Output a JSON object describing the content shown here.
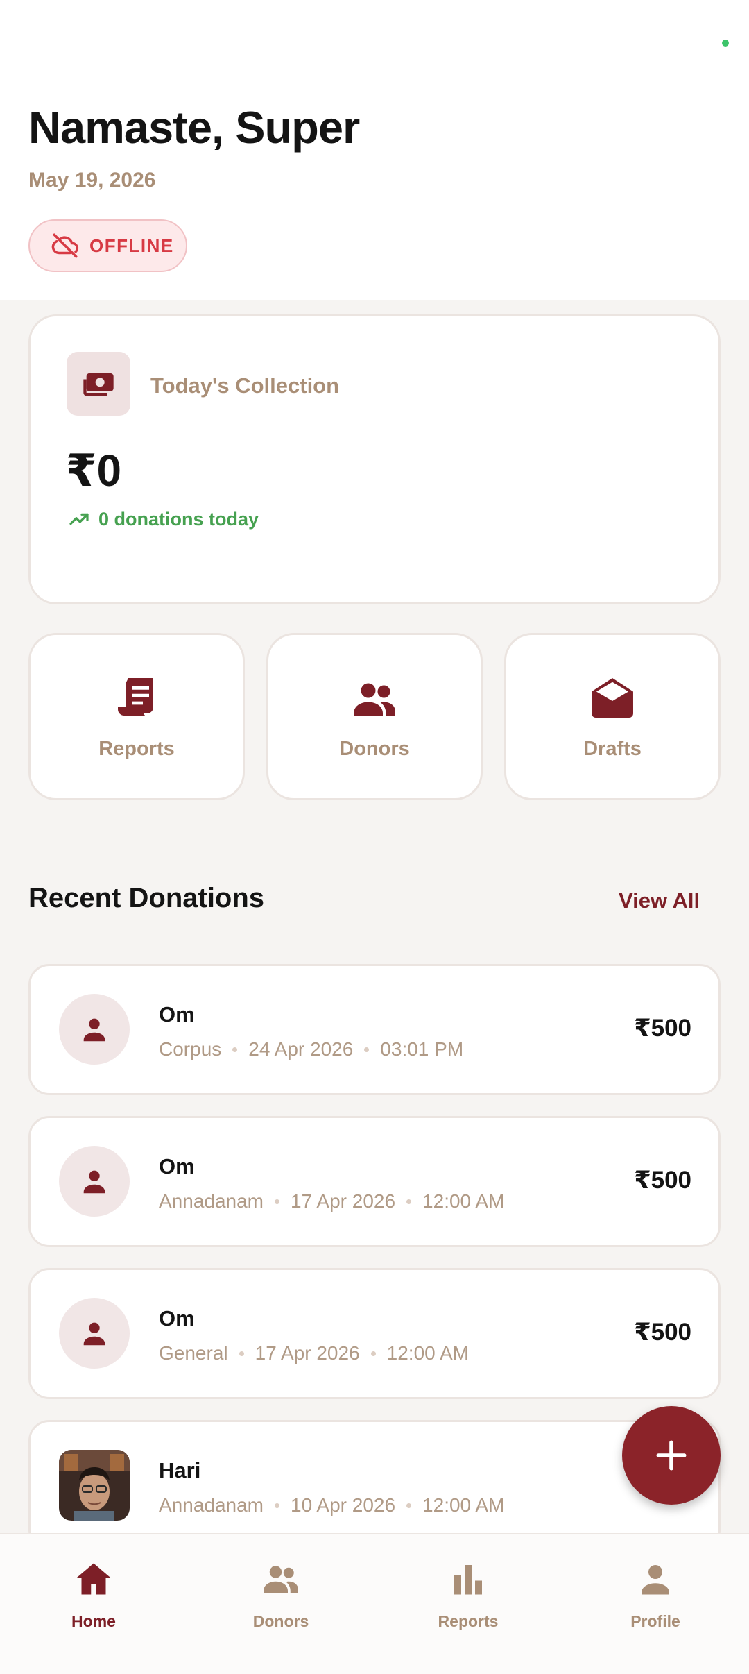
{
  "header": {
    "greeting": "Namaste, Super",
    "date": "May 19, 2026",
    "connection_status": "OFFLINE",
    "status_icon": "cloud-off-icon"
  },
  "collection": {
    "title": "Today's Collection",
    "amount": "₹0",
    "donations_today": "0 donations today",
    "icon": "payments-icon",
    "trend_icon": "trending-up-icon"
  },
  "quick_actions": [
    {
      "label": "Reports",
      "icon": "receipt-icon"
    },
    {
      "label": "Donors",
      "icon": "people-icon"
    },
    {
      "label": "Drafts",
      "icon": "drafts-icon"
    }
  ],
  "recent": {
    "title": "Recent Donations",
    "view_all": "View All",
    "items": [
      {
        "name": "Om",
        "category": "Corpus",
        "date": "24 Apr 2026",
        "time": "03:01 PM",
        "amount": "₹500",
        "avatar": "person-icon"
      },
      {
        "name": "Om",
        "category": "Annadanam",
        "date": "17 Apr 2026",
        "time": "12:00 AM",
        "amount": "₹500",
        "avatar": "person-icon"
      },
      {
        "name": "Om",
        "category": "General",
        "date": "17 Apr 2026",
        "time": "12:00 AM",
        "amount": "₹500",
        "avatar": "person-icon"
      },
      {
        "name": "Hari",
        "category": "Annadanam",
        "date": "10 Apr 2026",
        "time": "12:00 AM",
        "amount": "",
        "avatar": "photo"
      }
    ]
  },
  "fab": {
    "icon": "add-icon"
  },
  "nav": {
    "items": [
      {
        "label": "Home",
        "icon": "home-icon",
        "active": true
      },
      {
        "label": "Donors",
        "icon": "people-icon",
        "active": false
      },
      {
        "label": "Reports",
        "icon": "bar-chart-icon",
        "active": false
      },
      {
        "label": "Profile",
        "icon": "person-icon",
        "active": false
      }
    ]
  },
  "colors": {
    "brand": "#7d1f27",
    "accent_muted": "#a98e76",
    "success": "#46a150",
    "offline_red": "#d73a44",
    "online_dot": "#3cc46a"
  }
}
